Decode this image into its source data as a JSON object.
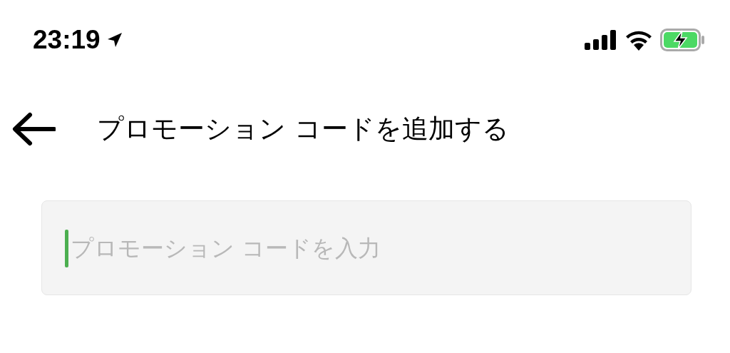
{
  "status_bar": {
    "time": "23:19",
    "charging": true
  },
  "header": {
    "title": "プロモーション コードを追加する"
  },
  "field": {
    "placeholder": "プロモーション コードを入力",
    "focused": true
  }
}
